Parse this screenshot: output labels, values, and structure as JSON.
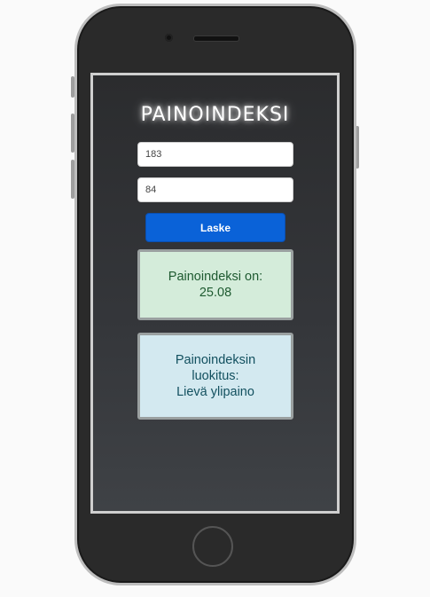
{
  "app": {
    "title": "PAINOINDEKSI"
  },
  "form": {
    "height_value": "183",
    "weight_value": "84",
    "calculate_label": "Laske"
  },
  "results": {
    "bmi_label": "Painoindeksi on:",
    "bmi_value": "25.08",
    "class_label_line1": "Painoindeksin",
    "class_label_line2": "luokitus:",
    "class_value": "Lievä ylipaino"
  },
  "colors": {
    "button": "#0a62d8",
    "bmi_box": "#d4ecda",
    "class_box": "#d3e9f0"
  },
  "icons": [
    "front-camera-icon",
    "speaker-icon",
    "home-button-icon"
  ]
}
